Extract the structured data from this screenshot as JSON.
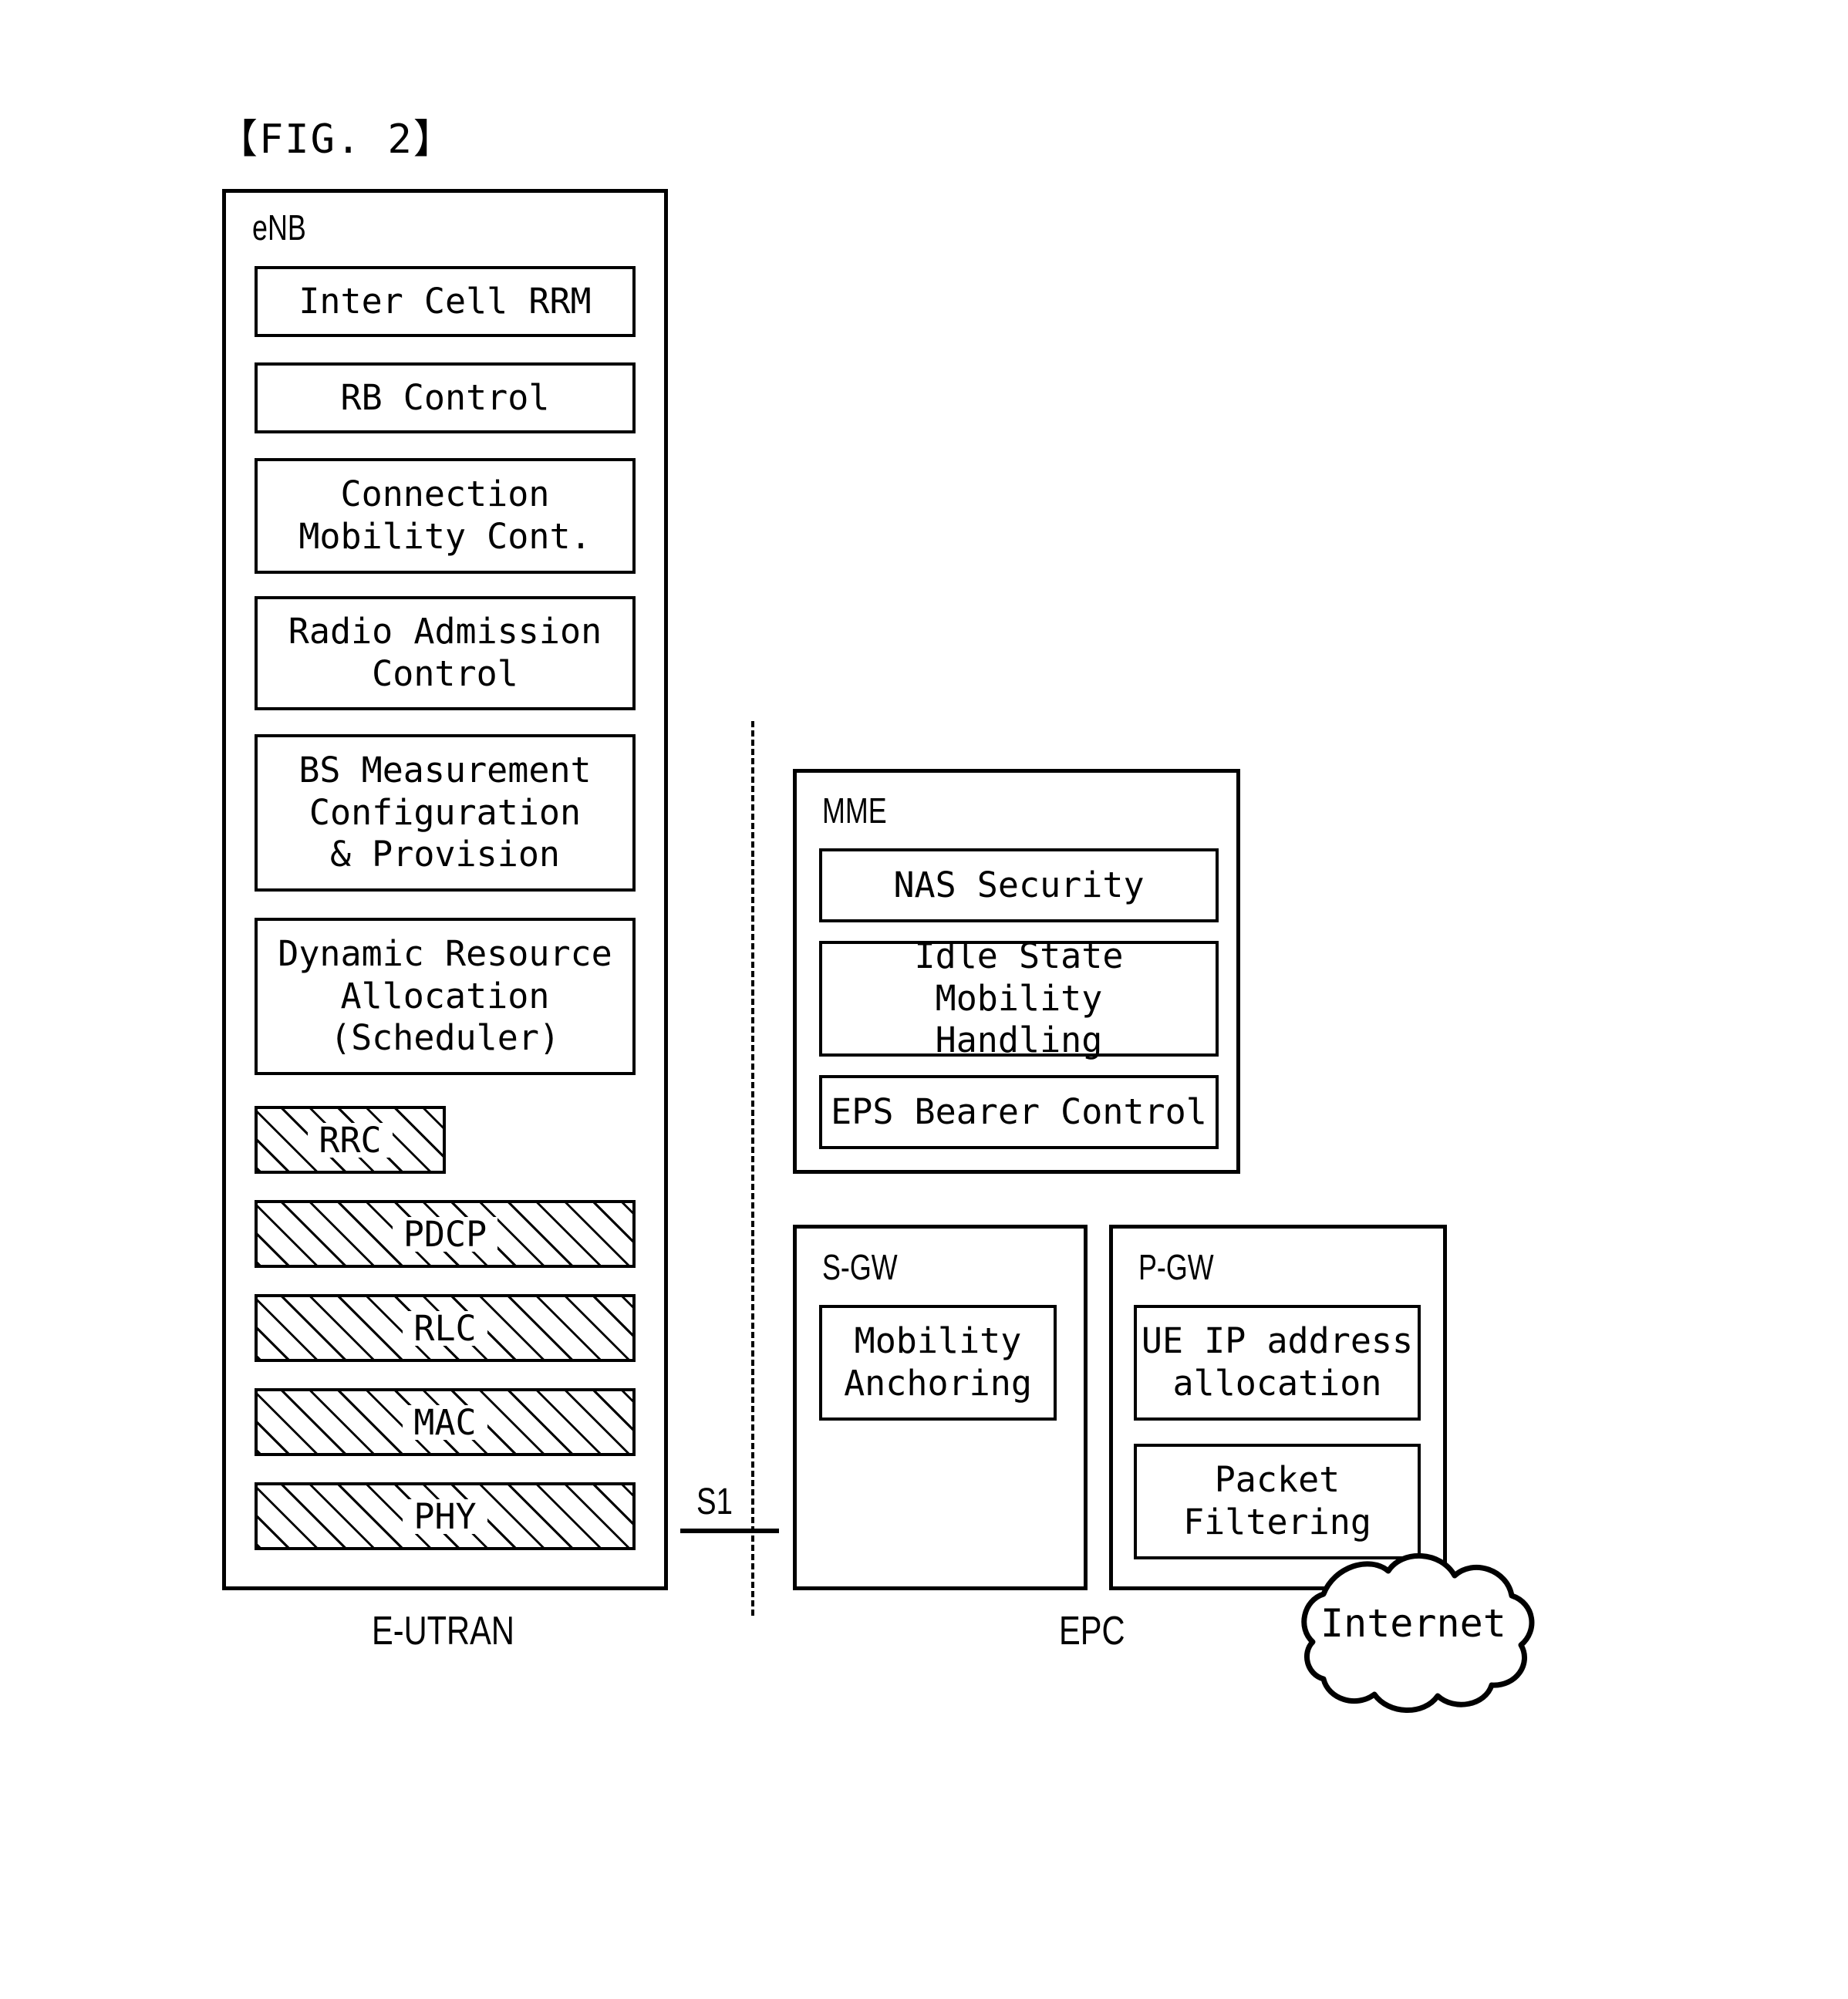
{
  "figure": {
    "title": "【FIG. 2】"
  },
  "enb": {
    "label": "eNB",
    "boxes": [
      {
        "text": "Inter Cell RRM",
        "hatched": false
      },
      {
        "text": "RB Control",
        "hatched": false
      },
      {
        "text": "Connection\nMobility Cont.",
        "hatched": false
      },
      {
        "text": "Radio Admission\nControl",
        "hatched": false
      },
      {
        "text": "BS Measurement\nConfiguration\n& Provision",
        "hatched": false
      },
      {
        "text": "Dynamic Resource\nAllocation\n(Scheduler)",
        "hatched": false
      },
      {
        "text": "RRC",
        "hatched": true
      },
      {
        "text": "PDCP",
        "hatched": true
      },
      {
        "text": "RLC",
        "hatched": true
      },
      {
        "text": "MAC",
        "hatched": true
      },
      {
        "text": "PHY",
        "hatched": true
      }
    ]
  },
  "mme": {
    "label": "MME",
    "boxes": [
      {
        "text": "NAS Security"
      },
      {
        "text": "Idle State Mobility\nHandling"
      },
      {
        "text": "EPS Bearer Control"
      }
    ]
  },
  "sgw": {
    "label": "S-GW",
    "boxes": [
      {
        "text": "Mobility\nAnchoring"
      }
    ]
  },
  "pgw": {
    "label": "P-GW",
    "boxes": [
      {
        "text": "UE IP address\nallocation"
      },
      {
        "text": "Packet\nFiltering"
      }
    ]
  },
  "interface": {
    "s1_label": "S1"
  },
  "regions": {
    "left": "E-UTRAN",
    "right": "EPC"
  },
  "internet": {
    "label": "Internet"
  },
  "colors": {
    "stroke": "#000000",
    "background": "#ffffff"
  }
}
